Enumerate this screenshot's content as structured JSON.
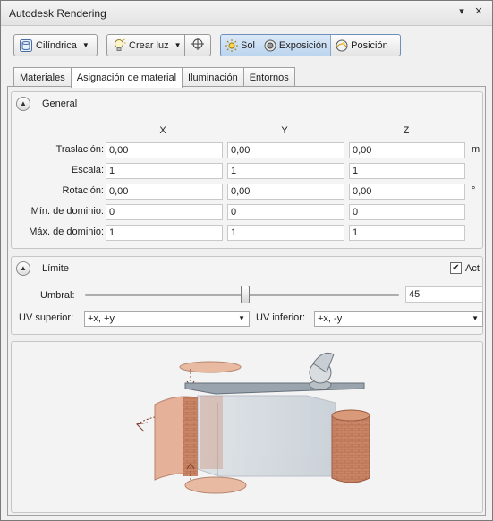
{
  "window": {
    "title": "Autodesk Rendering"
  },
  "toolbar": {
    "mapping_label": "Cilíndrica",
    "create_light_label": "Crear luz",
    "sun_label": "Sol",
    "exposure_label": "Exposición",
    "position_label": "Posición"
  },
  "tabs": [
    "Materiales",
    "Asignación de material",
    "Iluminación",
    "Entornos"
  ],
  "general": {
    "title": "General",
    "columns": [
      "X",
      "Y",
      "Z"
    ],
    "rows": [
      {
        "label": "Traslación:",
        "x": "0,00",
        "y": "0,00",
        "z": "0,00",
        "unit": "m"
      },
      {
        "label": "Escala:",
        "x": "1",
        "y": "1",
        "z": "1",
        "unit": ""
      },
      {
        "label": "Rotación:",
        "x": "0,00",
        "y": "0,00",
        "z": "0,00",
        "unit": "°"
      },
      {
        "label": "Mín. de dominio:",
        "x": "0",
        "y": "0",
        "z": "0",
        "unit": ""
      },
      {
        "label": "Máx. de dominio:",
        "x": "1",
        "y": "1",
        "z": "1",
        "unit": ""
      }
    ]
  },
  "limit": {
    "title": "Límite",
    "act_label": "Act",
    "act_checked": true,
    "threshold_label": "Umbral:",
    "threshold_value": "45",
    "threshold_fraction": 0.51,
    "uv_top_label": "UV superior:",
    "uv_top_value": "+x, +y",
    "uv_bottom_label": "UV inferior:",
    "uv_bottom_value": "+x, -y"
  },
  "colors": {
    "accent": "#6d8fb8",
    "copper": "#c98565",
    "glass": "#b8c4cf"
  }
}
